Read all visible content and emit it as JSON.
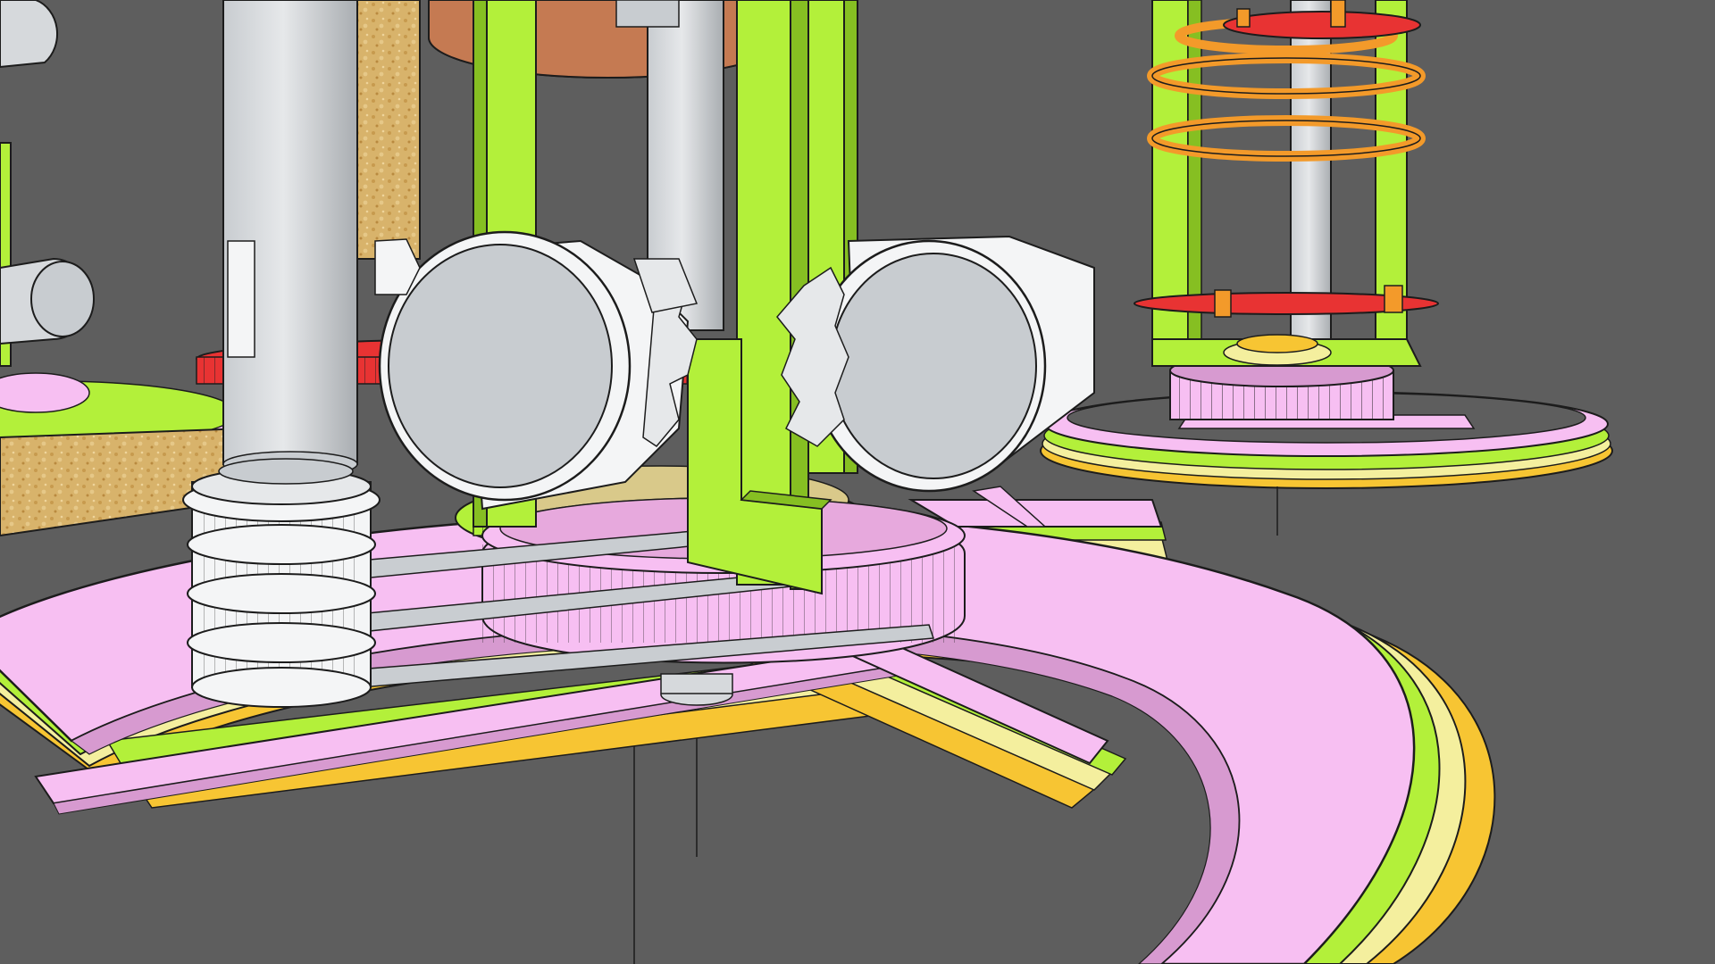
{
  "scene": {
    "background": "#5e5e5e",
    "palette": {
      "pink": "#f7bff2",
      "pink_dark": "#d79ad0",
      "lime": "#b3f03a",
      "lime_dark": "#86bf22",
      "cream": "#f4ef9e",
      "yellow": "#f7c533",
      "orange": "#f39a2a",
      "red": "#e83333",
      "grey": "#d6d9dc",
      "grey_dark": "#a9adb1",
      "white": "#f4f5f6",
      "cork": "#d8b36b",
      "outline": "#1c1c1c"
    }
  }
}
